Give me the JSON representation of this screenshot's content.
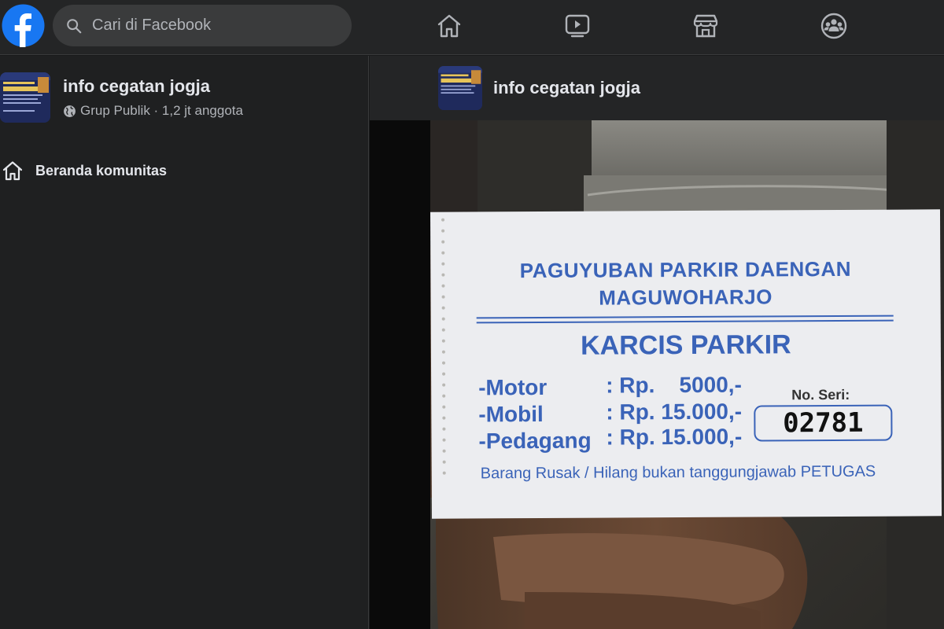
{
  "header": {
    "search_placeholder": "Cari di Facebook",
    "icons": [
      "facebook-logo",
      "search-icon",
      "home-icon",
      "video-icon",
      "marketplace-icon",
      "groups-icon"
    ]
  },
  "sidebar": {
    "group_name": "info cegatan jogja",
    "group_meta": "Grup Publik · 1,2 jt anggota",
    "nav_home_label": "Beranda komunitas"
  },
  "post": {
    "group_name": "info cegatan jogja",
    "ticket": {
      "org_line1": "PAGUYUBAN PARKIR DAENGAN",
      "org_line2": "MAGUWOHARJO",
      "title": "KARCIS PARKIR",
      "rates": [
        {
          "label": "-Motor",
          "value": ": Rp.    5000,-"
        },
        {
          "label": "-Mobil",
          "value": ": Rp. 15.000,-"
        },
        {
          "label": "-Pedagang",
          "value": ": Rp. 15.000,-"
        }
      ],
      "serial_label": "No. Seri:",
      "serial_number": "02781",
      "footer_note": "Barang Rusak / Hilang bukan tanggungjawab PETUGAS"
    }
  },
  "colors": {
    "bg": "#18191a",
    "surface": "#242526",
    "fb_blue": "#1877f2",
    "ticket_blue": "#3a63b8",
    "ticket_paper": "#ecedf0"
  }
}
